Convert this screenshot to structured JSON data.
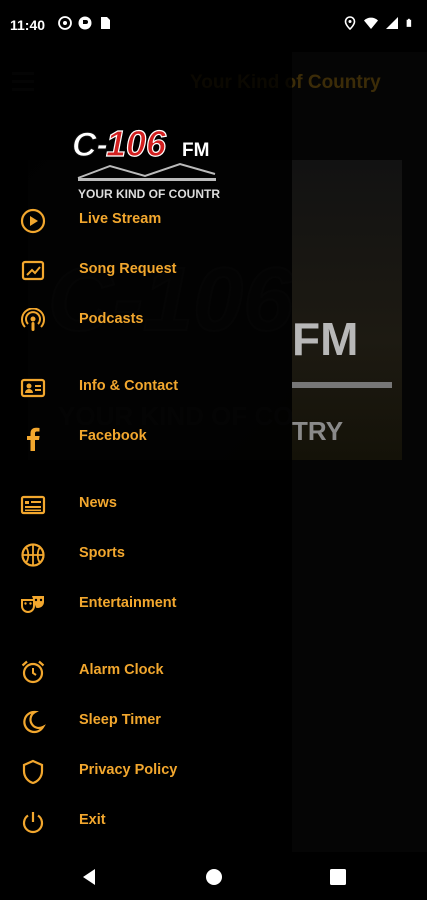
{
  "status_bar": {
    "time": "11:40",
    "left_icons": [
      "media-icon",
      "vpn-icon",
      "sim-icon"
    ],
    "right_icons": [
      "location-icon",
      "wifi-icon",
      "signal-icon",
      "battery-icon"
    ]
  },
  "app": {
    "title": "Your Kind of Country"
  },
  "drawer": {
    "logo": {
      "main": "C-106",
      "suffix": "FM",
      "tagline": "YOUR KIND OF COUNTRY"
    },
    "items": [
      {
        "label": "Live Stream",
        "icon": "play-circle-icon"
      },
      {
        "label": "Song Request",
        "icon": "request-icon"
      },
      {
        "label": "Podcasts",
        "icon": "podcast-icon"
      },
      {
        "label": "Info & Contact",
        "icon": "contact-card-icon"
      },
      {
        "label": "Facebook",
        "icon": "facebook-icon"
      },
      {
        "label": "News",
        "icon": "news-icon"
      },
      {
        "label": "Sports",
        "icon": "basketball-icon"
      },
      {
        "label": "Entertainment",
        "icon": "theater-masks-icon"
      },
      {
        "label": "Alarm Clock",
        "icon": "alarm-clock-icon"
      },
      {
        "label": "Sleep Timer",
        "icon": "moon-icon"
      },
      {
        "label": "Privacy Policy",
        "icon": "shield-icon"
      },
      {
        "label": "Exit",
        "icon": "power-icon"
      }
    ]
  },
  "colors": {
    "accent": "#f2a72e",
    "logo_red": "#d21f1f",
    "background": "#000000"
  },
  "nav_bar": {
    "buttons": [
      "back-icon",
      "home-icon",
      "recents-icon"
    ]
  }
}
